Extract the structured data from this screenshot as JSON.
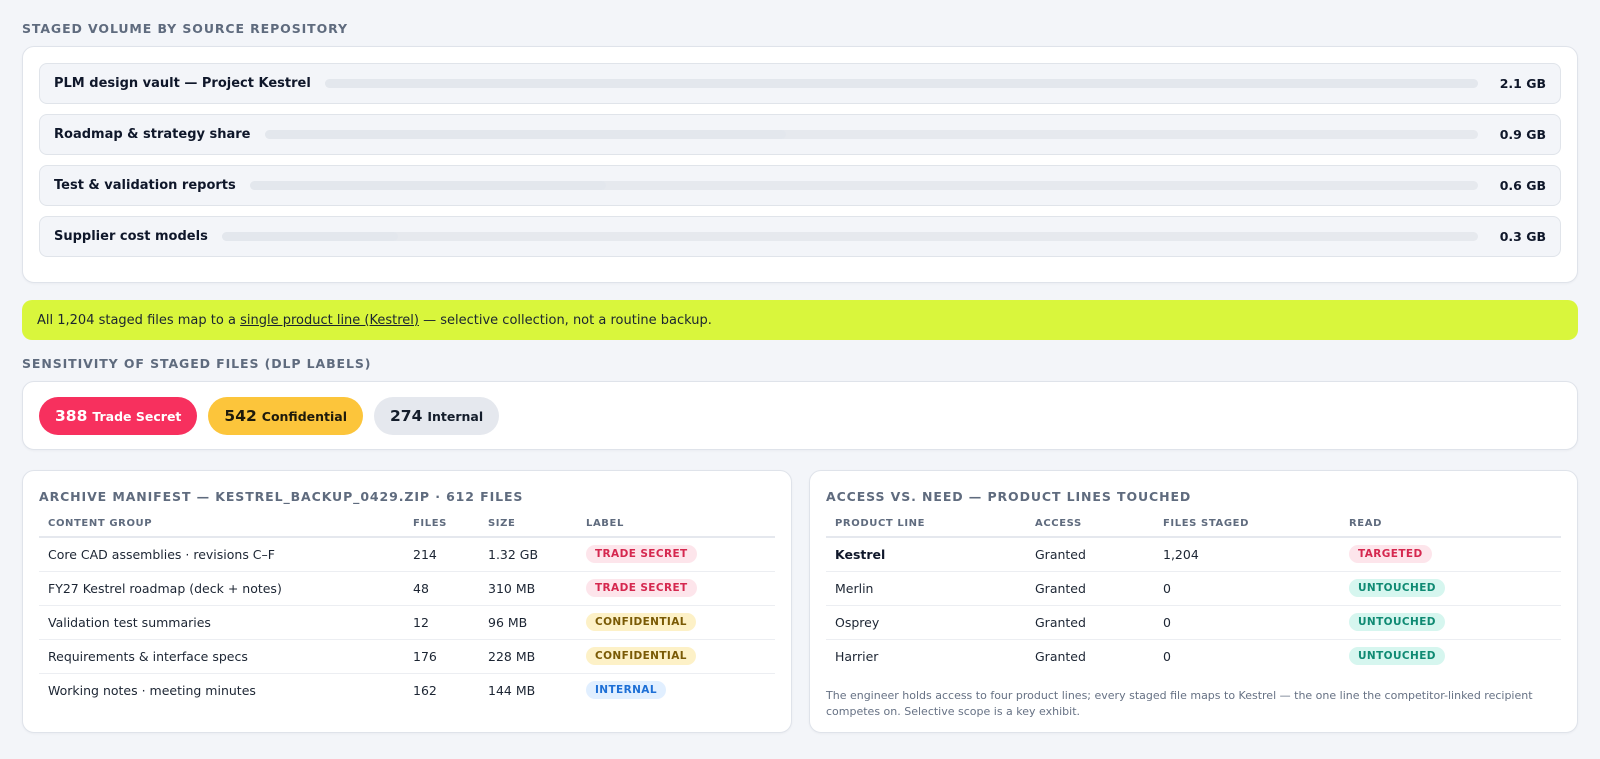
{
  "volume": {
    "title": "Staged volume by source repository",
    "repos": [
      {
        "name": "PLM design vault — Project Kestrel",
        "size": "2.1 GB",
        "fraction": 1.0
      },
      {
        "name": "Roadmap & strategy share",
        "size": "0.9 GB",
        "fraction": 0.43
      },
      {
        "name": "Test & validation reports",
        "size": "0.6 GB",
        "fraction": 0.29
      },
      {
        "name": "Supplier cost models",
        "size": "0.3 GB",
        "fraction": 0.14
      }
    ]
  },
  "callout": {
    "prefix": "All 1,204 staged files map to a ",
    "link": "single product line (Kestrel)",
    "suffix": " — selective collection, not a routine backup."
  },
  "sensitivity": {
    "title": "Sensitivity of staged files (DLP labels)",
    "pills": [
      {
        "count": "388",
        "label": "Trade Secret"
      },
      {
        "count": "542",
        "label": "Confidential"
      },
      {
        "count": "274",
        "label": "Internal"
      }
    ]
  },
  "manifest": {
    "title": "Archive manifest — kestrel_backup_0429.zip · 612 files",
    "columns": [
      "Content group",
      "Files",
      "Size",
      "Label"
    ],
    "rows": [
      {
        "group": "Core CAD assemblies · revisions C–F",
        "files": "214",
        "size": "1.32 GB",
        "label": "Trade Secret"
      },
      {
        "group": "FY27 Kestrel roadmap (deck + notes)",
        "files": "48",
        "size": "310 MB",
        "label": "Trade Secret"
      },
      {
        "group": "Validation test summaries",
        "files": "12",
        "size": "96 MB",
        "label": "Confidential"
      },
      {
        "group": "Requirements & interface specs",
        "files": "176",
        "size": "228 MB",
        "label": "Confidential"
      },
      {
        "group": "Working notes · meeting minutes",
        "files": "162",
        "size": "144 MB",
        "label": "Internal"
      }
    ]
  },
  "access": {
    "title": "Access vs. need — product lines touched",
    "columns": [
      "Product line",
      "Access",
      "Files staged",
      "Read"
    ],
    "rows": [
      {
        "line": "Kestrel",
        "access": "Granted",
        "staged": "1,204",
        "read": "Targeted"
      },
      {
        "line": "Merlin",
        "access": "Granted",
        "staged": "0",
        "read": "Untouched"
      },
      {
        "line": "Osprey",
        "access": "Granted",
        "staged": "0",
        "read": "Untouched"
      },
      {
        "line": "Harrier",
        "access": "Granted",
        "staged": "0",
        "read": "Untouched"
      }
    ],
    "note": "The engineer holds access to four product lines; every staged file maps to Kestrel — the one line the competitor-linked recipient competes on. Selective scope is a key exhibit."
  }
}
